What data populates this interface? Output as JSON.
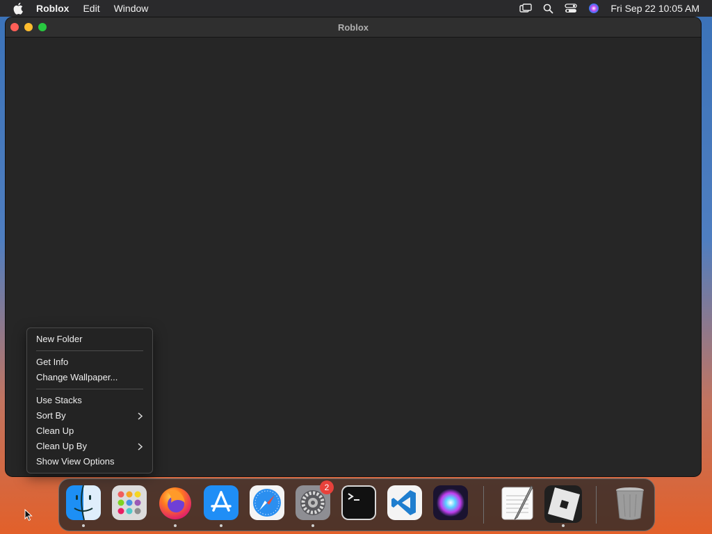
{
  "menubar": {
    "app_name": "Roblox",
    "menus": [
      "Edit",
      "Window"
    ],
    "clock": "Fri Sep 22  10:05 AM",
    "icons": [
      "apple-icon",
      "screen-mirroring-icon",
      "search-icon",
      "control-center-icon",
      "siri-icon"
    ]
  },
  "window": {
    "title": "Roblox",
    "traffic_lights": {
      "close": "#ff5f57",
      "minimize": "#febc2e",
      "zoom": "#28c840"
    }
  },
  "context_menu": {
    "items": [
      {
        "label": "New Folder"
      },
      {
        "label": "Get Info"
      },
      {
        "label": "Change Wallpaper..."
      },
      {
        "label": "Use Stacks"
      },
      {
        "label": "Sort By",
        "submenu_indicator": ">"
      },
      {
        "label": "Clean Up"
      },
      {
        "label": "Clean Up By",
        "submenu_indicator": ">"
      },
      {
        "label": "Show View Options"
      }
    ]
  },
  "dock": {
    "apps": [
      {
        "name": "finder-icon",
        "running": true
      },
      {
        "name": "launchpad-icon",
        "running": false
      },
      {
        "name": "firefox-icon",
        "running": true
      },
      {
        "name": "app-store-icon",
        "running": true
      },
      {
        "name": "safari-icon",
        "running": false
      },
      {
        "name": "system-settings-icon",
        "running": true,
        "badge": "2"
      },
      {
        "name": "terminal-icon",
        "running": false
      },
      {
        "name": "vscode-icon",
        "running": false
      },
      {
        "name": "siri-icon",
        "running": false
      },
      {
        "name": "textedit-icon",
        "running": false
      },
      {
        "name": "roblox-icon",
        "running": true
      },
      {
        "name": "trash-icon",
        "running": false
      }
    ]
  }
}
